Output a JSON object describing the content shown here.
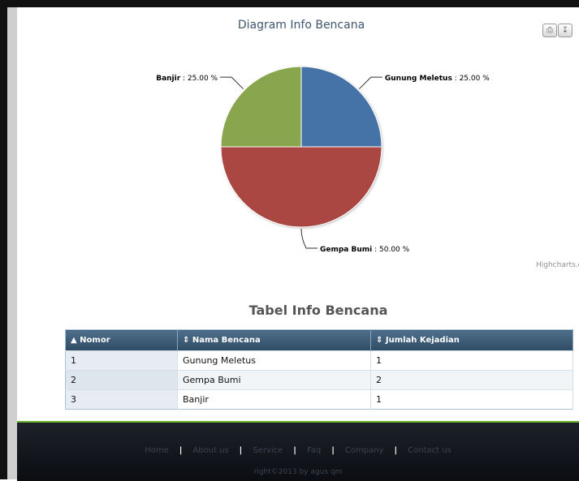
{
  "chart_data": {
    "type": "pie",
    "title": "Diagram Info Bencana",
    "slices": [
      {
        "name": "Gunung Meletus",
        "value": 25.0,
        "label": "25.00 %",
        "color": "#4572a7"
      },
      {
        "name": "Gempa Bumi",
        "value": 50.0,
        "label": "50.00 %",
        "color": "#aa4643"
      },
      {
        "name": "Banjir",
        "value": 25.0,
        "label": "25.00 %",
        "color": "#89a54e"
      }
    ],
    "credit": "Highcharts.com"
  },
  "toolbar": {
    "print_icon": "printer-icon",
    "download_icon": "download-icon"
  },
  "table": {
    "title": "Tabel Info Bencana",
    "headers": [
      "▲ Nomor",
      "⇕ Nama Bencana",
      "⇕ Jumlah Kejadian"
    ],
    "rows": [
      [
        "1",
        "Gunung Meletus",
        "1"
      ],
      [
        "2",
        "Gempa Bumi",
        "2"
      ],
      [
        "3",
        "Banjir",
        "1"
      ]
    ]
  },
  "footer": {
    "links": [
      "Home",
      "About us",
      "Service",
      "Faq",
      "Company",
      "Contact us"
    ],
    "separator": "|",
    "copyright": "right©2013 by agus qm"
  }
}
